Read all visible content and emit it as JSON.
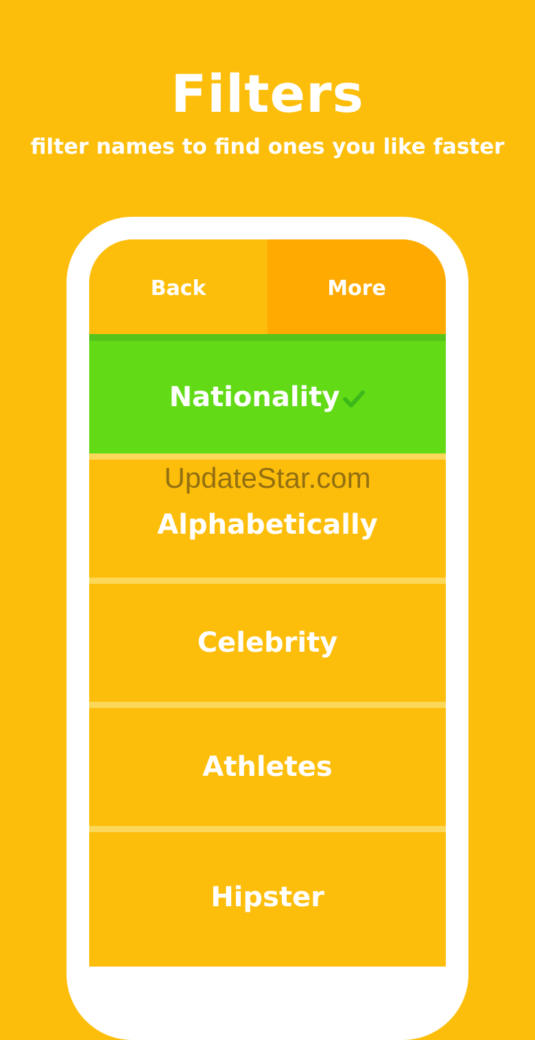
{
  "header": {
    "title": "Filters",
    "subtitle": "filter names to find ones you like faster"
  },
  "topbar": {
    "back_label": "Back",
    "more_label": "More"
  },
  "filters": [
    {
      "label": "Nationality",
      "selected": true,
      "icon": "checkmark-icon"
    },
    {
      "label": "Alphabetically",
      "selected": false
    },
    {
      "label": "Celebrity",
      "selected": false
    },
    {
      "label": "Athletes",
      "selected": false
    },
    {
      "label": "Hipster",
      "selected": false
    }
  ],
  "watermark": "UpdateStar.com",
  "colors": {
    "background": "#FDBE0B",
    "more_button": "#FEAA00",
    "selected_row": "#62DB16",
    "check": "#3DB81A"
  }
}
